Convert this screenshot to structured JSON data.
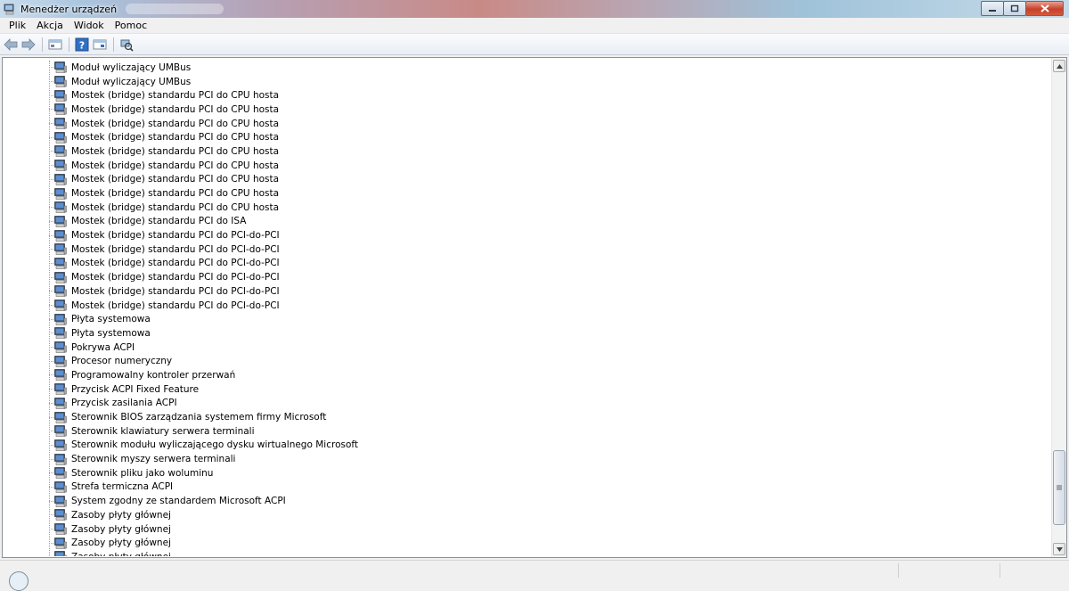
{
  "window": {
    "title": "Menedżer urządzeń",
    "controls": {
      "minimize_icon": "minimize-icon",
      "maximize_icon": "maximize-icon",
      "close_icon": "close-icon"
    }
  },
  "menu": [
    {
      "label": "Plik"
    },
    {
      "label": "Akcja"
    },
    {
      "label": "Widok"
    },
    {
      "label": "Pomoc"
    }
  ],
  "toolbar": {
    "buttons": [
      "back-arrow-icon",
      "forward-arrow-icon",
      "console-tree-icon",
      "help-icon",
      "properties-icon",
      "scan-hardware-icon"
    ]
  },
  "tree": {
    "items": [
      {
        "label": "Moduł wyliczający UMBus"
      },
      {
        "label": "Moduł wyliczający UMBus"
      },
      {
        "label": "Mostek (bridge) standardu PCI do CPU hosta"
      },
      {
        "label": "Mostek (bridge) standardu PCI do CPU hosta"
      },
      {
        "label": "Mostek (bridge) standardu PCI do CPU hosta"
      },
      {
        "label": "Mostek (bridge) standardu PCI do CPU hosta"
      },
      {
        "label": "Mostek (bridge) standardu PCI do CPU hosta"
      },
      {
        "label": "Mostek (bridge) standardu PCI do CPU hosta"
      },
      {
        "label": "Mostek (bridge) standardu PCI do CPU hosta"
      },
      {
        "label": "Mostek (bridge) standardu PCI do CPU hosta"
      },
      {
        "label": "Mostek (bridge) standardu PCI do CPU hosta"
      },
      {
        "label": "Mostek (bridge) standardu PCI do ISA"
      },
      {
        "label": "Mostek (bridge) standardu PCI do PCI-do-PCI"
      },
      {
        "label": "Mostek (bridge) standardu PCI do PCI-do-PCI"
      },
      {
        "label": "Mostek (bridge) standardu PCI do PCI-do-PCI"
      },
      {
        "label": "Mostek (bridge) standardu PCI do PCI-do-PCI"
      },
      {
        "label": "Mostek (bridge) standardu PCI do PCI-do-PCI"
      },
      {
        "label": "Mostek (bridge) standardu PCI do PCI-do-PCI"
      },
      {
        "label": "Płyta systemowa"
      },
      {
        "label": "Płyta systemowa"
      },
      {
        "label": "Pokrywa ACPI"
      },
      {
        "label": "Procesor numeryczny"
      },
      {
        "label": "Programowalny kontroler przerwań"
      },
      {
        "label": "Przycisk ACPI Fixed Feature"
      },
      {
        "label": "Przycisk zasilania ACPI"
      },
      {
        "label": "Sterownik BIOS zarządzania systemem firmy Microsoft"
      },
      {
        "label": "Sterownik klawiatury serwera terminali"
      },
      {
        "label": "Sterownik modułu wyliczającego dysku wirtualnego Microsoft"
      },
      {
        "label": "Sterownik myszy serwera terminali"
      },
      {
        "label": "Sterownik pliku jako woluminu"
      },
      {
        "label": "Strefa termiczna ACPI"
      },
      {
        "label": "System zgodny ze standardem Microsoft ACPI"
      },
      {
        "label": "Zasoby płyty głównej"
      },
      {
        "label": "Zasoby płyty głównej"
      },
      {
        "label": "Zasoby płyty głównej"
      },
      {
        "label": "Zasoby płyty głównej"
      }
    ],
    "item_icon": "system-device-icon"
  },
  "scrollbar": {
    "position_fraction": 0.92
  },
  "colors": {
    "tree_bg": "#ffffff",
    "chrome_bg": "#f0f0f0",
    "close_red": "#c7402a"
  }
}
